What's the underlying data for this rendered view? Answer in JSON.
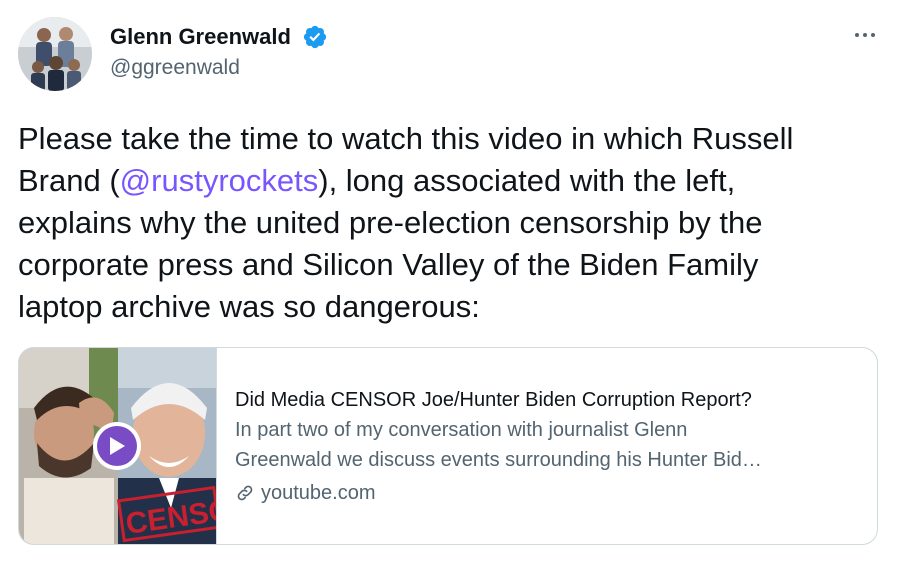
{
  "author": {
    "name": "Glenn Greenwald",
    "handle": "@ggreenwald",
    "verified": true
  },
  "tweet": {
    "lines": [
      [
        "Please take the time to watch this video in which Russell"
      ],
      [
        "Brand (",
        "@rustyrockets",
        "), long associated with the left,"
      ],
      [
        "explains why the united pre-election censorship by the"
      ],
      [
        "corporate press and Silicon Valley of the Biden Family"
      ],
      [
        "laptop archive was so dangerous:"
      ]
    ],
    "mention": "@rustyrockets"
  },
  "card": {
    "title": "Did Media CENSOR Joe/Hunter Biden Corruption Report?",
    "description_lines": [
      "In part two of my conversation with journalist Glenn",
      "Greenwald we discuss events surrounding his Hunter Bid…"
    ],
    "domain": "youtube.com",
    "thumbnail_stamp": "CENSO"
  },
  "icons": {
    "verified": "verified-badge-icon",
    "more": "more-options-icon",
    "play": "play-icon",
    "link": "link-icon"
  },
  "colors": {
    "verified": "#1d9bf0",
    "mention": "#7856ff",
    "play": "#794bc4",
    "secondary_text": "#536471",
    "border": "#cfd9de"
  }
}
